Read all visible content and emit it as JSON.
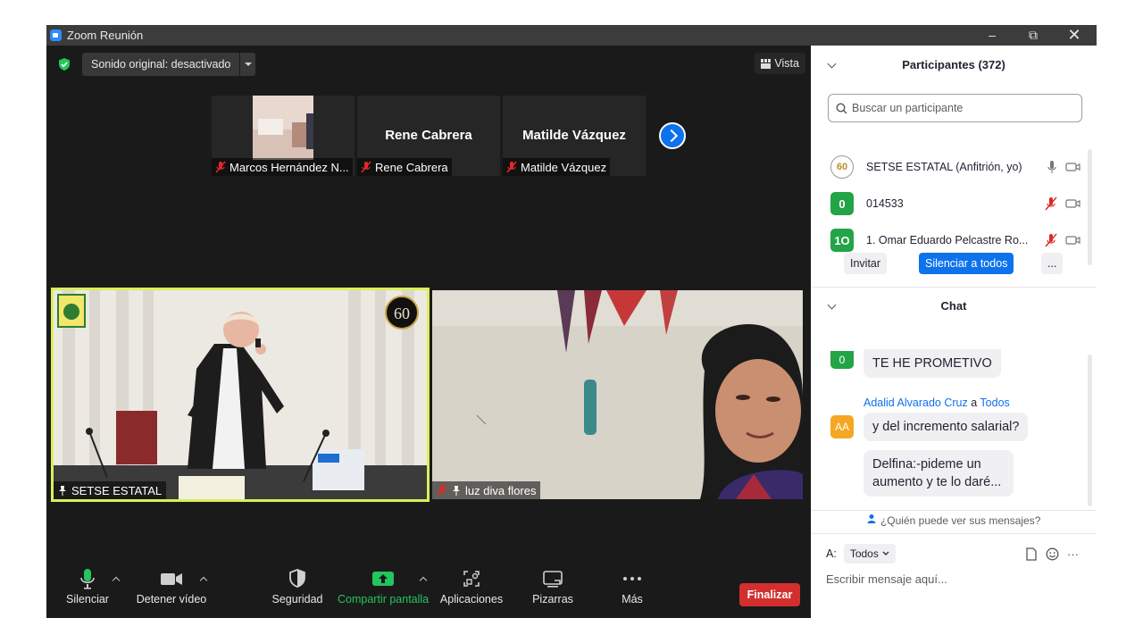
{
  "window": {
    "title": "Zoom Reunión"
  },
  "meeting": {
    "audio_label": "Sonido original: desactivado",
    "view_label": "Vista",
    "thumbnails": [
      {
        "big_name": "",
        "label": "Marcos Hernández N..."
      },
      {
        "big_name": "Rene Cabrera",
        "label": "Rene Cabrera"
      },
      {
        "big_name": "Matilde Vázquez",
        "label": "Matilde Vázquez"
      }
    ],
    "main_tiles": [
      {
        "label": "SETSE ESTATAL",
        "badge": "60"
      },
      {
        "label": "luz diva flores"
      }
    ]
  },
  "toolbar": {
    "mute": "Silenciar",
    "video": "Detener vídeo",
    "security": "Seguridad",
    "share": "Compartir pantalla",
    "apps": "Aplicaciones",
    "whiteboards": "Pizarras",
    "more": "Más",
    "end": "Finalizar"
  },
  "participants": {
    "title": "Participantes (372)",
    "search_placeholder": "Buscar un participante",
    "list": [
      {
        "avatar": "60",
        "name": "SETSE ESTATAL (Anfitrión, yo)"
      },
      {
        "avatar": "0",
        "name": "014533"
      },
      {
        "avatar": "1O",
        "name": "1. Omar Eduardo Pelcastre Ro..."
      }
    ],
    "invite": "Invitar",
    "mute_all": "Silenciar a todos",
    "more": "..."
  },
  "chat": {
    "title": "Chat",
    "messages": [
      {
        "avatar": "0",
        "text": "TE HE PROMETIVO"
      },
      {
        "sender": "Adalid Alvarado Cruz",
        "sep": "a",
        "to": "Todos",
        "avatar": "AA",
        "text": "y del incremento salarial?"
      },
      {
        "text_line1": "Delfina:-pideme un",
        "text_line2": "aumento y te lo daré..."
      }
    ],
    "who_sees": "¿Quién puede ver sus mensajes?",
    "to_label": "A:",
    "to_value": "Todos",
    "input_placeholder": "Escribir mensaje aquí...",
    "more": "···"
  },
  "colors": {
    "accent": "#0e72ed",
    "end": "#d32f2f",
    "share": "#22c55e",
    "active_speaker": "#d9f058",
    "avatar_green": "#22a447",
    "avatar_orange": "#f5a623"
  }
}
